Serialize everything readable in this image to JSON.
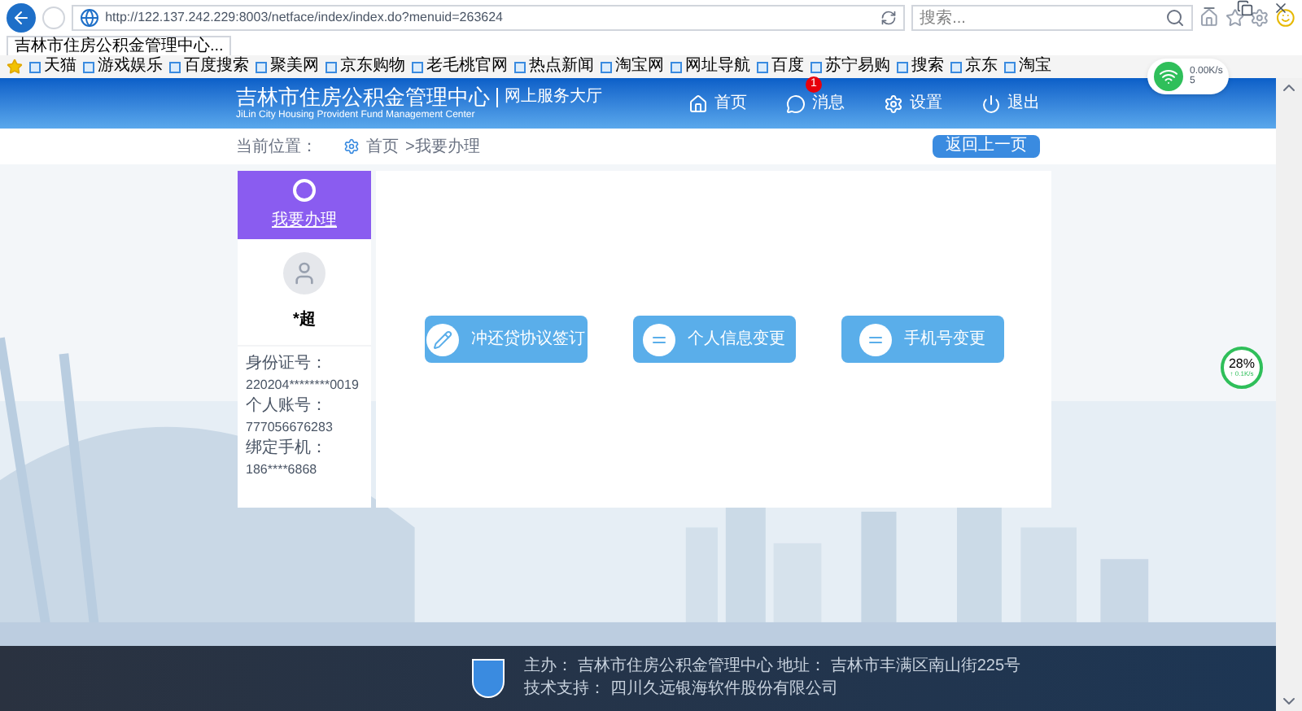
{
  "browser": {
    "address": "http://122.137.242.229:8003/netface/index/index.do?menuid=263624",
    "tab_title": "吉林市住房公积金管理中心...",
    "search_placeholder": "搜索...",
    "bookmarks": [
      "天猫",
      "游戏娱乐",
      "百度搜索",
      "聚美网",
      "京东购物",
      "老毛桃官网",
      "热点新闻",
      "淘宝网",
      "网址导航",
      "百度",
      "苏宁易购",
      "搜索",
      "京东",
      "淘宝"
    ]
  },
  "net_widget": {
    "speed": "0.00K/s",
    "count": "5"
  },
  "header": {
    "title": "吉林市住房公积金管理中心",
    "subtitle": "网上服务大厅",
    "english": "JiLin City Housing Provident Fund Management Center",
    "nav": [
      {
        "label": "首页",
        "kind": "home"
      },
      {
        "label": "消息",
        "kind": "message",
        "badge": "1"
      },
      {
        "label": "设置",
        "kind": "settings"
      },
      {
        "label": "退出",
        "kind": "logout"
      }
    ]
  },
  "breadcrumb": {
    "label": "当前位置：",
    "home": "首页",
    "current": ">我要办理"
  },
  "back_button": "返回上一页",
  "sidebar": {
    "title": "我要办理",
    "name": "*超",
    "fields": [
      {
        "label": "身份证号：",
        "value": "220204********0019"
      },
      {
        "label": "个人账号：",
        "value": "777056676283"
      },
      {
        "label": "绑定手机：",
        "value": "186****6868"
      }
    ]
  },
  "actions": [
    {
      "label": "冲还贷协议签订",
      "kind": "pen"
    },
    {
      "label": "个人信息变更",
      "kind": "lines"
    },
    {
      "label": "手机号变更",
      "kind": "lines"
    }
  ],
  "speed_meter": {
    "percent": "28%",
    "rate": "↑ 0.1K/s"
  },
  "footer": {
    "sponsor_label": "主办：",
    "sponsor": "吉林市住房公积金管理中心",
    "address_label": "地址：",
    "address": "吉林市丰满区南山街225号",
    "support_label": "技术支持：",
    "support": "四川久远银海软件股份有限公司"
  }
}
